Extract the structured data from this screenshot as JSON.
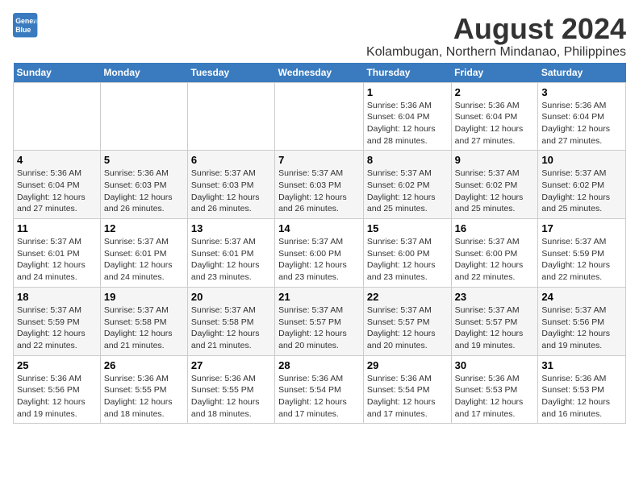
{
  "logo": {
    "line1": "General",
    "line2": "Blue"
  },
  "title": "August 2024",
  "subtitle": "Kolambugan, Northern Mindanao, Philippines",
  "weekdays": [
    "Sunday",
    "Monday",
    "Tuesday",
    "Wednesday",
    "Thursday",
    "Friday",
    "Saturday"
  ],
  "weeks": [
    [
      {
        "day": "",
        "info": ""
      },
      {
        "day": "",
        "info": ""
      },
      {
        "day": "",
        "info": ""
      },
      {
        "day": "",
        "info": ""
      },
      {
        "day": "1",
        "info": "Sunrise: 5:36 AM\nSunset: 6:04 PM\nDaylight: 12 hours\nand 28 minutes."
      },
      {
        "day": "2",
        "info": "Sunrise: 5:36 AM\nSunset: 6:04 PM\nDaylight: 12 hours\nand 27 minutes."
      },
      {
        "day": "3",
        "info": "Sunrise: 5:36 AM\nSunset: 6:04 PM\nDaylight: 12 hours\nand 27 minutes."
      }
    ],
    [
      {
        "day": "4",
        "info": "Sunrise: 5:36 AM\nSunset: 6:04 PM\nDaylight: 12 hours\nand 27 minutes."
      },
      {
        "day": "5",
        "info": "Sunrise: 5:36 AM\nSunset: 6:03 PM\nDaylight: 12 hours\nand 26 minutes."
      },
      {
        "day": "6",
        "info": "Sunrise: 5:37 AM\nSunset: 6:03 PM\nDaylight: 12 hours\nand 26 minutes."
      },
      {
        "day": "7",
        "info": "Sunrise: 5:37 AM\nSunset: 6:03 PM\nDaylight: 12 hours\nand 26 minutes."
      },
      {
        "day": "8",
        "info": "Sunrise: 5:37 AM\nSunset: 6:02 PM\nDaylight: 12 hours\nand 25 minutes."
      },
      {
        "day": "9",
        "info": "Sunrise: 5:37 AM\nSunset: 6:02 PM\nDaylight: 12 hours\nand 25 minutes."
      },
      {
        "day": "10",
        "info": "Sunrise: 5:37 AM\nSunset: 6:02 PM\nDaylight: 12 hours\nand 25 minutes."
      }
    ],
    [
      {
        "day": "11",
        "info": "Sunrise: 5:37 AM\nSunset: 6:01 PM\nDaylight: 12 hours\nand 24 minutes."
      },
      {
        "day": "12",
        "info": "Sunrise: 5:37 AM\nSunset: 6:01 PM\nDaylight: 12 hours\nand 24 minutes."
      },
      {
        "day": "13",
        "info": "Sunrise: 5:37 AM\nSunset: 6:01 PM\nDaylight: 12 hours\nand 23 minutes."
      },
      {
        "day": "14",
        "info": "Sunrise: 5:37 AM\nSunset: 6:00 PM\nDaylight: 12 hours\nand 23 minutes."
      },
      {
        "day": "15",
        "info": "Sunrise: 5:37 AM\nSunset: 6:00 PM\nDaylight: 12 hours\nand 23 minutes."
      },
      {
        "day": "16",
        "info": "Sunrise: 5:37 AM\nSunset: 6:00 PM\nDaylight: 12 hours\nand 22 minutes."
      },
      {
        "day": "17",
        "info": "Sunrise: 5:37 AM\nSunset: 5:59 PM\nDaylight: 12 hours\nand 22 minutes."
      }
    ],
    [
      {
        "day": "18",
        "info": "Sunrise: 5:37 AM\nSunset: 5:59 PM\nDaylight: 12 hours\nand 22 minutes."
      },
      {
        "day": "19",
        "info": "Sunrise: 5:37 AM\nSunset: 5:58 PM\nDaylight: 12 hours\nand 21 minutes."
      },
      {
        "day": "20",
        "info": "Sunrise: 5:37 AM\nSunset: 5:58 PM\nDaylight: 12 hours\nand 21 minutes."
      },
      {
        "day": "21",
        "info": "Sunrise: 5:37 AM\nSunset: 5:57 PM\nDaylight: 12 hours\nand 20 minutes."
      },
      {
        "day": "22",
        "info": "Sunrise: 5:37 AM\nSunset: 5:57 PM\nDaylight: 12 hours\nand 20 minutes."
      },
      {
        "day": "23",
        "info": "Sunrise: 5:37 AM\nSunset: 5:57 PM\nDaylight: 12 hours\nand 19 minutes."
      },
      {
        "day": "24",
        "info": "Sunrise: 5:37 AM\nSunset: 5:56 PM\nDaylight: 12 hours\nand 19 minutes."
      }
    ],
    [
      {
        "day": "25",
        "info": "Sunrise: 5:36 AM\nSunset: 5:56 PM\nDaylight: 12 hours\nand 19 minutes."
      },
      {
        "day": "26",
        "info": "Sunrise: 5:36 AM\nSunset: 5:55 PM\nDaylight: 12 hours\nand 18 minutes."
      },
      {
        "day": "27",
        "info": "Sunrise: 5:36 AM\nSunset: 5:55 PM\nDaylight: 12 hours\nand 18 minutes."
      },
      {
        "day": "28",
        "info": "Sunrise: 5:36 AM\nSunset: 5:54 PM\nDaylight: 12 hours\nand 17 minutes."
      },
      {
        "day": "29",
        "info": "Sunrise: 5:36 AM\nSunset: 5:54 PM\nDaylight: 12 hours\nand 17 minutes."
      },
      {
        "day": "30",
        "info": "Sunrise: 5:36 AM\nSunset: 5:53 PM\nDaylight: 12 hours\nand 17 minutes."
      },
      {
        "day": "31",
        "info": "Sunrise: 5:36 AM\nSunset: 5:53 PM\nDaylight: 12 hours\nand 16 minutes."
      }
    ]
  ]
}
